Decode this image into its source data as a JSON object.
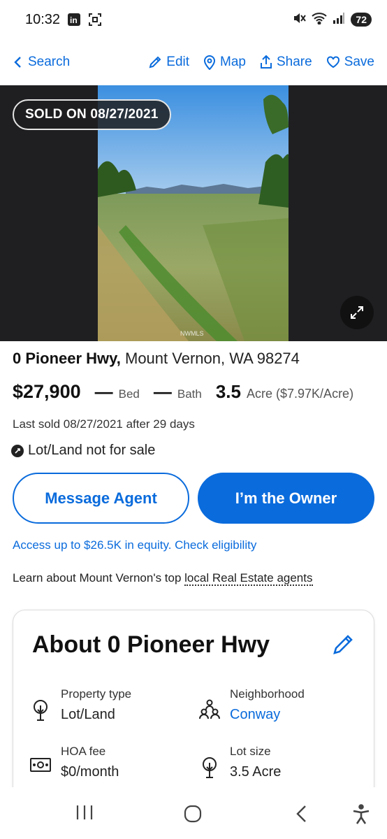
{
  "status_bar": {
    "time": "10:32",
    "battery": "72"
  },
  "nav": {
    "back_label": "Search",
    "edit_label": "Edit",
    "map_label": "Map",
    "share_label": "Share",
    "save_label": "Save"
  },
  "photo": {
    "badge": "SOLD ON 08/27/2021",
    "watermark": "NWMLS"
  },
  "listing": {
    "street": "0 Pioneer Hwy,",
    "city_state_zip": "Mount Vernon, WA 98274",
    "price": "$27,900",
    "beds_value": "—",
    "beds_label": "Bed",
    "baths_value": "—",
    "baths_label": "Bath",
    "lot_value": "3.5",
    "lot_label": "Acre ($7.97K/Acre)",
    "last_sold": "Last sold 08/27/2021 after 29 days",
    "status": "Lot/Land not for sale"
  },
  "actions": {
    "message_agent": "Message Agent",
    "owner": "I’m the Owner",
    "equity": "Access up to $26.5K in equity. Check eligibility",
    "learn_prefix": "Learn about Mount Vernon's top ",
    "learn_link": "local Real Estate agents"
  },
  "about": {
    "title": "About 0 Pioneer Hwy",
    "facts": [
      {
        "label": "Property type",
        "value": "Lot/Land",
        "icon": "tree-icon"
      },
      {
        "label": "Neighborhood",
        "value": "Conway",
        "icon": "people-icon"
      },
      {
        "label": "HOA fee",
        "value": "$0/month",
        "icon": "money-icon"
      },
      {
        "label": "Lot size",
        "value": "3.5 Acre",
        "icon": "tree-icon"
      }
    ]
  },
  "colors": {
    "accent": "#0a6bdc",
    "photo_bg": "#1f1f22"
  }
}
